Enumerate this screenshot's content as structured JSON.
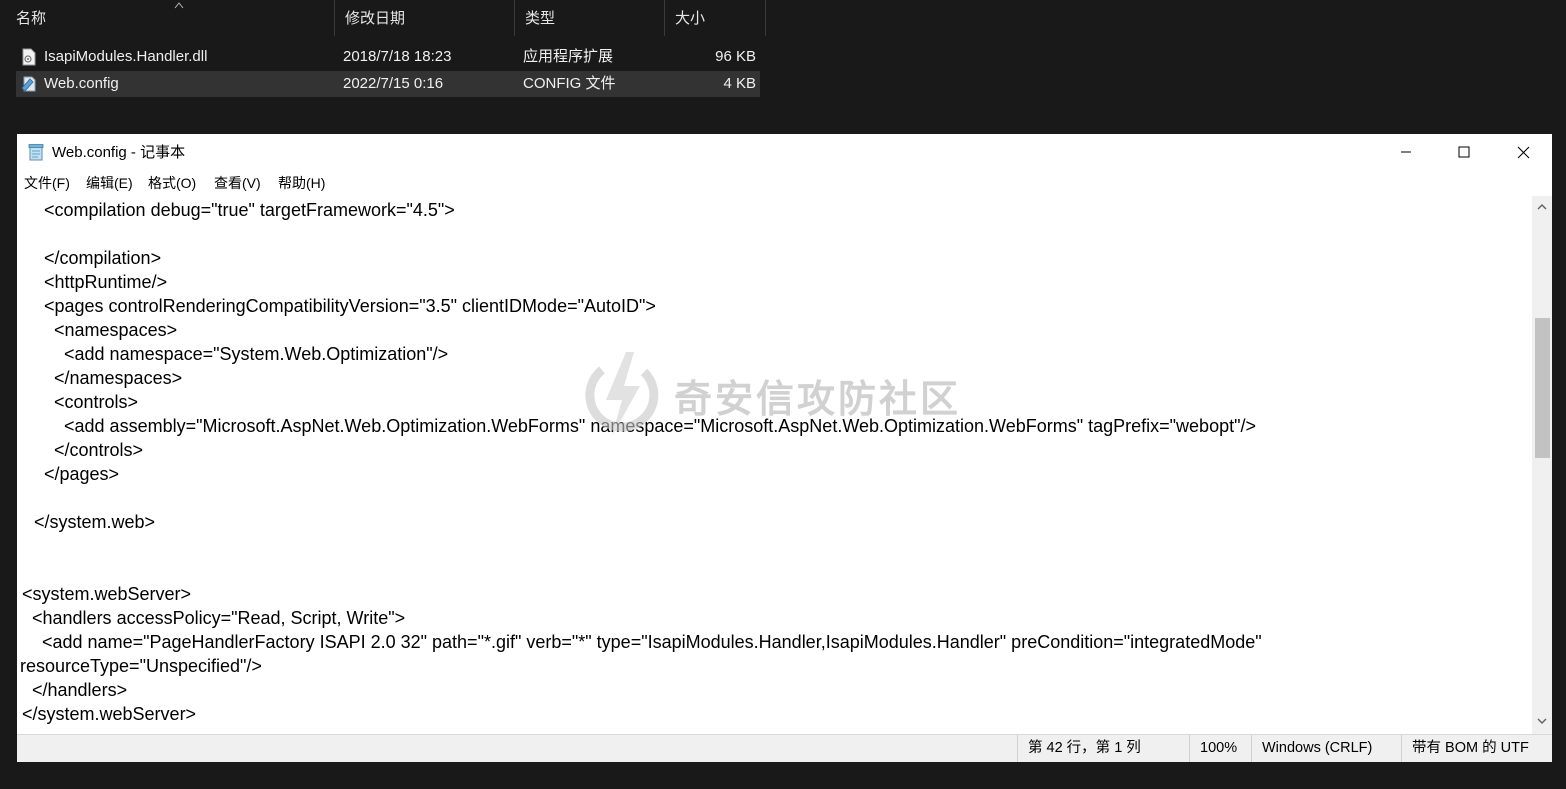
{
  "explorer": {
    "columns": {
      "name": "名称",
      "modified": "修改日期",
      "type": "类型",
      "size": "大小"
    },
    "files": [
      {
        "name": "IsapiModules.Handler.dll",
        "modified": "2018/7/18 18:23",
        "type": "应用程序扩展",
        "size": "96 KB",
        "icon": "dll-file-icon",
        "selected": false
      },
      {
        "name": "Web.config",
        "modified": "2022/7/15 0:16",
        "type": "CONFIG 文件",
        "size": "4 KB",
        "icon": "config-file-icon",
        "selected": true
      }
    ]
  },
  "notepad": {
    "title": "Web.config - 记事本",
    "menu": [
      "文件(F)",
      "编辑(E)",
      "格式(O)",
      "查看(V)",
      "帮助(H)"
    ],
    "lines": [
      "    <compilation debug=\"true\" targetFramework=\"4.5\">",
      "",
      "    </compilation>",
      "    <httpRuntime/>",
      "    <pages controlRenderingCompatibilityVersion=\"3.5\" clientIDMode=\"AutoID\">",
      "      <namespaces>",
      "        <add namespace=\"System.Web.Optimization\"/>",
      "      </namespaces>",
      "      <controls>",
      "        <add assembly=\"Microsoft.AspNet.Web.Optimization.WebForms\" namespace=\"Microsoft.AspNet.Web.Optimization.WebForms\" tagPrefix=\"webopt\"/>",
      "      </controls>",
      "    </pages>",
      "",
      "  </system.web>",
      "",
      "",
      " <system.webServer>",
      "   <handlers accessPolicy=\"Read, Script, Write\">",
      "     <add name=\"PageHandlerFactory ISAPI 2.0 32\" path=\"*.gif\" verb=\"*\" type=\"IsapiModules.Handler,IsapiModules.Handler\" preCondition=\"integratedMode\"",
      "resourceType=\"Unspecified\"/>",
      "   </handlers>",
      " </system.webServer>"
    ],
    "status": {
      "position": "第 42 行，第 1 列",
      "zoom": "100%",
      "line_ending": "Windows (CRLF)",
      "encoding": "带有 BOM 的 UTF"
    }
  },
  "watermark": {
    "text": "奇安信攻防社区"
  }
}
